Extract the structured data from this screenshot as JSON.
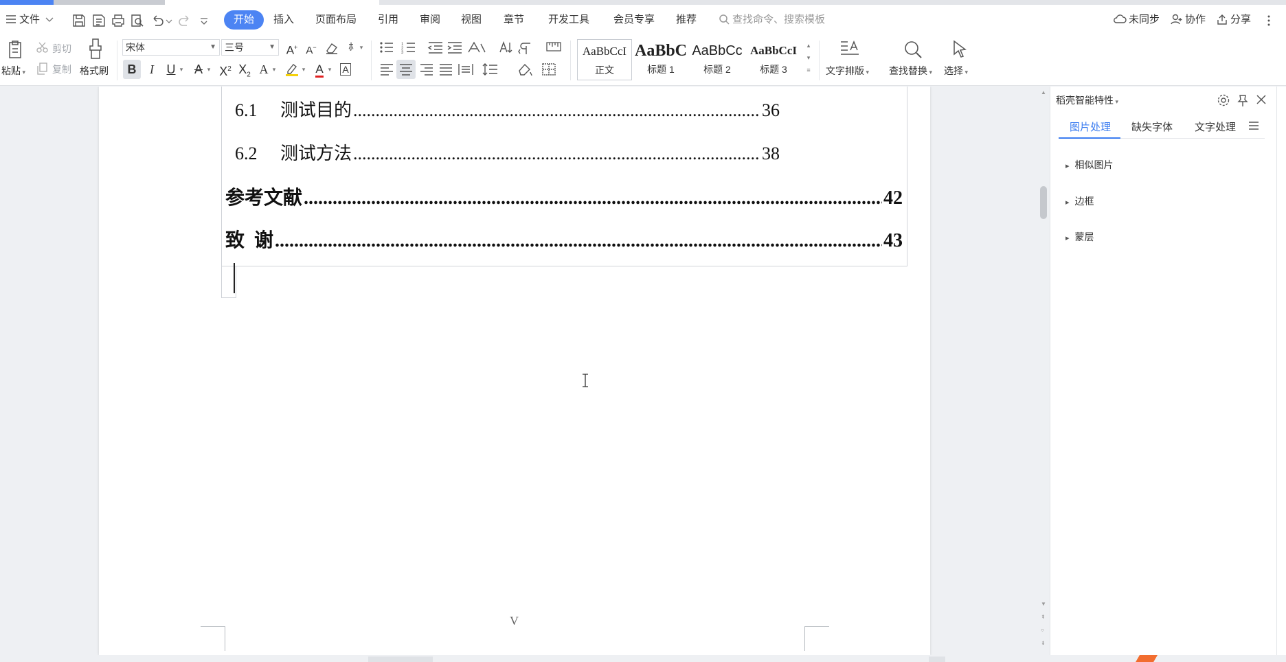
{
  "menu": {
    "file_label": "文件",
    "tabs": [
      "开始",
      "插入",
      "页面布局",
      "引用",
      "审阅",
      "视图",
      "章节",
      "开发工具",
      "会员专享",
      "推荐"
    ],
    "search_placeholder": "查找命令、搜索模板",
    "sync_label": "未同步",
    "collab_label": "协作",
    "share_label": "分享"
  },
  "ribbon": {
    "paste": "粘贴",
    "cut": "剪切",
    "copy": "复制",
    "format_painter": "格式刷",
    "font_name": "宋体",
    "font_size": "三号",
    "styles": [
      {
        "preview": "AaBbCcI",
        "label": "正文"
      },
      {
        "preview": "AaBbC",
        "label": "标题 1"
      },
      {
        "preview": "AaBbCc",
        "label": "标题 2"
      },
      {
        "preview": "AaBbCcI",
        "label": "标题 3"
      }
    ],
    "text_layout": "文字排版",
    "find_replace": "查找替换",
    "select": "选择"
  },
  "document": {
    "toc": [
      {
        "num": "6.1",
        "title": "测试目的",
        "page": "36",
        "level": 2
      },
      {
        "num": "6.2",
        "title": "测试方法",
        "page": "38",
        "level": 2
      },
      {
        "num": "",
        "title": "参考文献",
        "page": "42",
        "level": 1
      },
      {
        "num": "",
        "title": "致  谢",
        "page": "43",
        "level": 1
      }
    ],
    "page_number": "V"
  },
  "panel": {
    "title": "稻壳智能特性",
    "tabs": [
      "图片处理",
      "缺失字体",
      "文字处理"
    ],
    "items": [
      "相似图片",
      "边框",
      "蒙层"
    ]
  },
  "colors": {
    "accent": "#4c84f3",
    "panel_accent": "#3b7cf0"
  }
}
